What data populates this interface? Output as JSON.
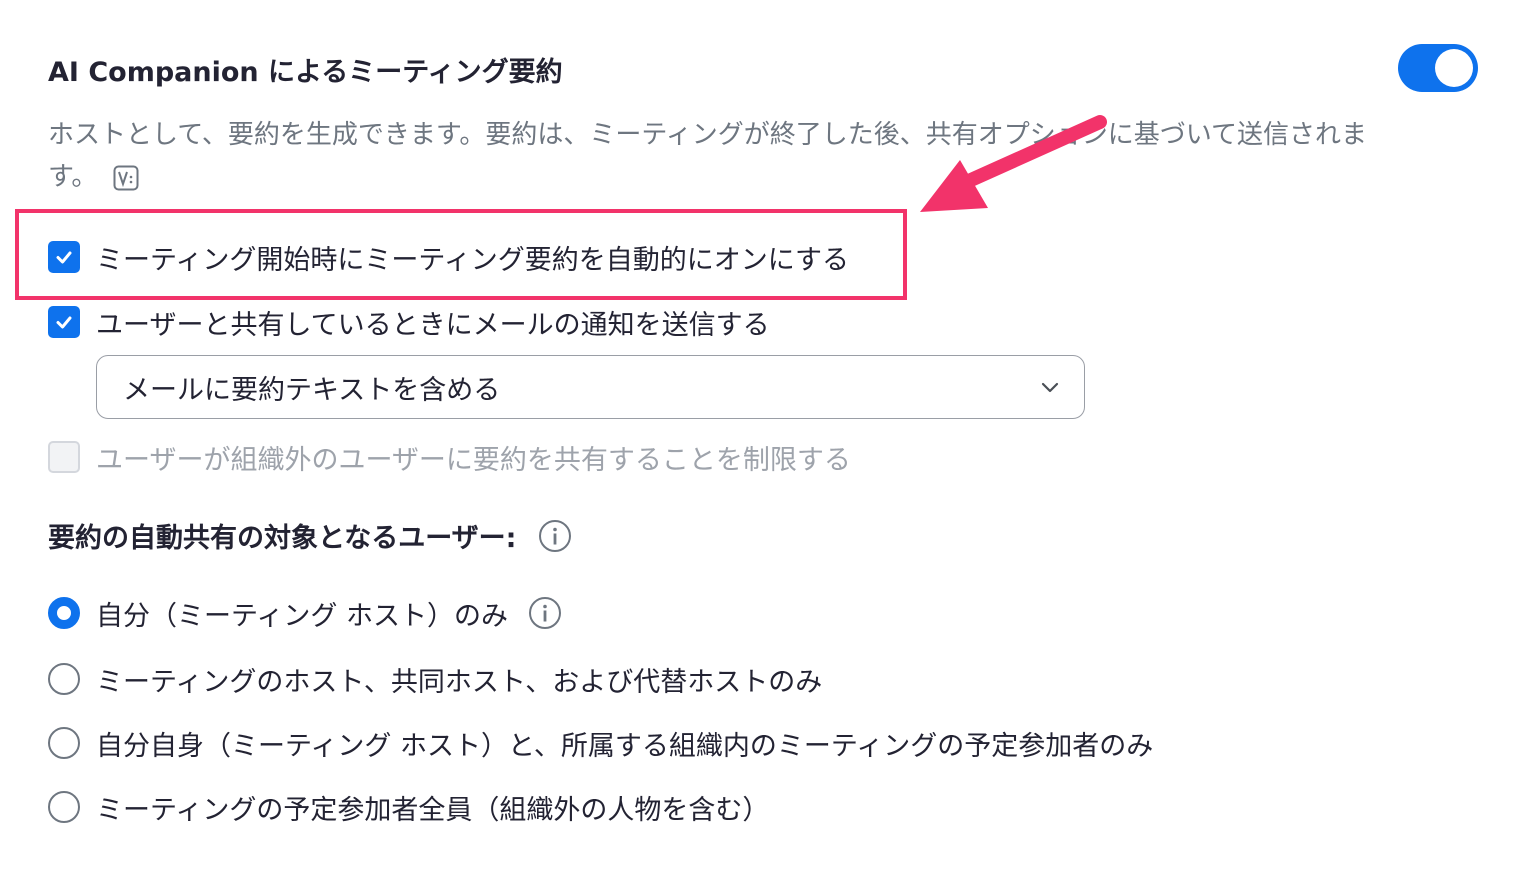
{
  "header": {
    "title": "AI Companion によるミーティング要約",
    "toggle_state": "on",
    "description": "ホストとして、要約を生成できます。要約は、ミーティングが終了した後、共有オプションに基づいて送信されます。"
  },
  "options": [
    {
      "label": "ミーティング開始時にミーティング要約を自動的にオンにする",
      "checked": true
    },
    {
      "label": "ユーザーと共有しているときにメールの通知を送信する",
      "checked": true
    },
    {
      "label": "ユーザーが組織外のユーザーに要約を共有することを制限する",
      "checked": false,
      "disabled": true
    }
  ],
  "email_dropdown": {
    "value": "メールに要約テキストを含める"
  },
  "share_section": {
    "title": "要約の自動共有の対象となるユーザー:",
    "radios": [
      {
        "label": "自分（ミーティング ホスト）のみ",
        "selected": true
      },
      {
        "label": "ミーティングのホスト、共同ホスト、および代替ホストのみ",
        "selected": false
      },
      {
        "label": "自分自身（ミーティング ホスト）と、所属する組織内のミーティングの予定参加者のみ",
        "selected": false
      },
      {
        "label": "ミーティングの予定参加者全員（組織外の人物を含む）",
        "selected": false
      }
    ]
  },
  "colors": {
    "accent": "#0e72ed",
    "highlight": "#f2336a",
    "muted_text": "#6e7680"
  },
  "icons": {
    "description_icon": "vc-badge-icon",
    "info": "info-icon",
    "dropdown": "chevron-down-icon",
    "check": "checkmark-icon",
    "annotation": "pink-arrow"
  }
}
